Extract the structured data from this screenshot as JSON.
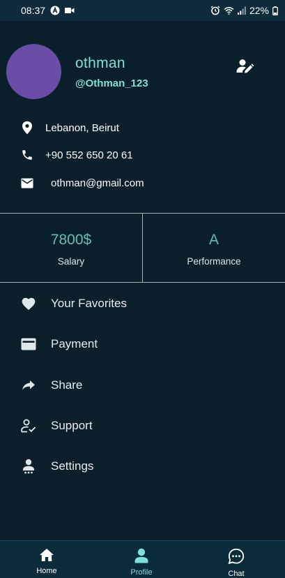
{
  "status_bar": {
    "time": "08:37",
    "battery": "22%",
    "icons": [
      "a-badge-icon",
      "video-icon",
      "alarm-icon",
      "wifi-icon",
      "signal-icon",
      "battery-icon"
    ]
  },
  "profile": {
    "name": "othman",
    "handle": "@Othman_123",
    "location": "Lebanon, Beirut",
    "phone": "+90 552 650 20 61",
    "email": "othman@gmail.com",
    "avatar_color": "#6a4da6"
  },
  "stats": [
    {
      "value": "7800$",
      "label": "Salary"
    },
    {
      "value": "A",
      "label": "Performance"
    }
  ],
  "menu": [
    {
      "label": "Your Favorites",
      "icon": "heart-icon"
    },
    {
      "label": "Payment",
      "icon": "credit-card-icon"
    },
    {
      "label": "Share",
      "icon": "share-icon"
    },
    {
      "label": "Support",
      "icon": "support-icon"
    },
    {
      "label": "Settings",
      "icon": "settings-user-icon"
    }
  ],
  "bottom_nav": [
    {
      "label": "Home",
      "icon": "home-icon",
      "active": false
    },
    {
      "label": "Profile",
      "icon": "profile-icon",
      "active": true
    },
    {
      "label": "Chat",
      "icon": "chat-icon",
      "active": false
    }
  ],
  "colors": {
    "background": "#0b1f2b",
    "accent": "#7fe0d8",
    "stat_value": "#5fbfb6",
    "active_nav": "#7fe0d8"
  }
}
